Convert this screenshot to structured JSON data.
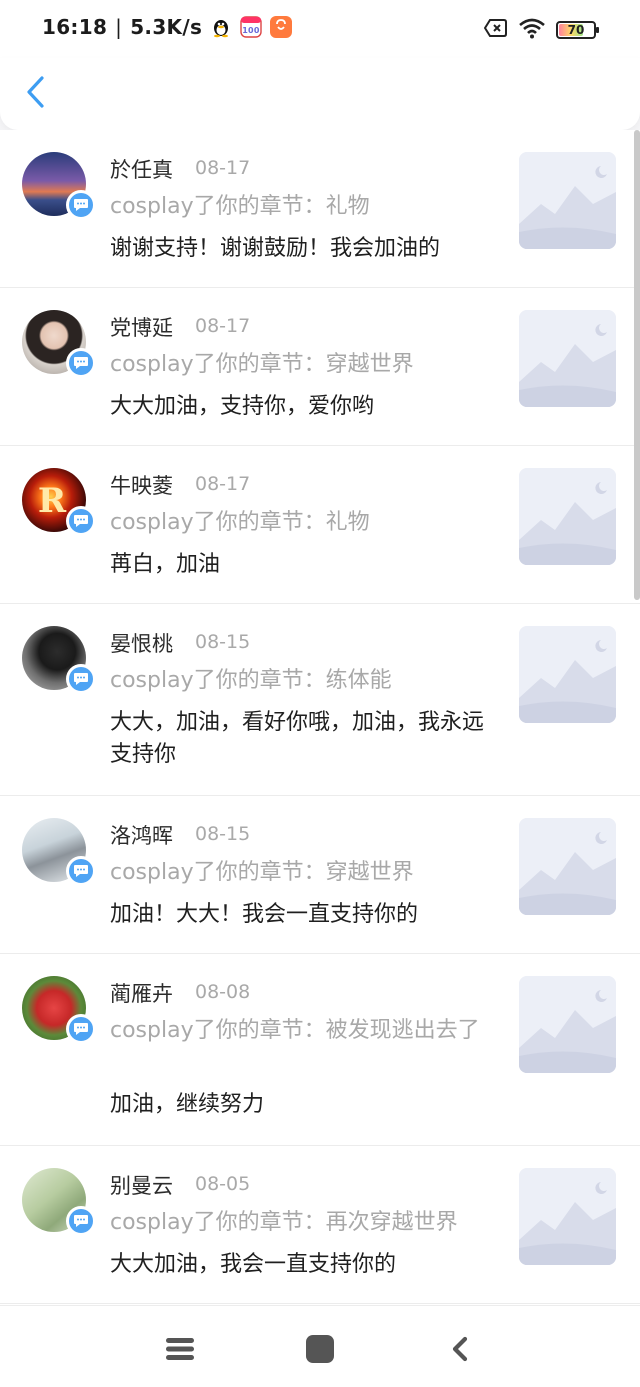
{
  "status_bar": {
    "time": "16:18",
    "separator": "|",
    "speed": "5.3K/s",
    "battery": "70"
  },
  "feed": [
    {
      "name": "於任真",
      "date": "08-17",
      "chapter": "cosplay了你的章节：礼物",
      "comment": "谢谢支持！谢谢鼓励！我会加油的"
    },
    {
      "name": "党博延",
      "date": "08-17",
      "chapter": "cosplay了你的章节：穿越世界",
      "comment": "大大加油，支持你，爱你哟"
    },
    {
      "name": "牛映菱",
      "date": "08-17",
      "chapter": "cosplay了你的章节：礼物",
      "comment": "苒白，加油"
    },
    {
      "name": "晏恨桃",
      "date": "08-15",
      "chapter": "cosplay了你的章节：练体能",
      "comment": "大大，加油，看好你哦，加油，我永远支持你"
    },
    {
      "name": "洛鸿晖",
      "date": "08-15",
      "chapter": "cosplay了你的章节：穿越世界",
      "comment": "加油！大大！我会一直支持你的"
    },
    {
      "name": "蔺雁卉",
      "date": "08-08",
      "chapter": "cosplay了你的章节：被发现逃出去了",
      "comment": "加油，继续努力"
    },
    {
      "name": "别曼云",
      "date": "08-05",
      "chapter": "cosplay了你的章节：再次穿越世界",
      "comment": "大大加油，我会一直支持你的"
    }
  ],
  "icons": {
    "back": "chevron-left-icon",
    "badge": "comment-bubble-icon",
    "thumbnail": "image-placeholder-icon",
    "nav_menu": "menu-icon",
    "nav_home": "home-square-icon",
    "nav_back": "back-arrow-icon"
  },
  "colors": {
    "accent": "#4fa4f4",
    "name_text": "#2b2b2b",
    "muted_text": "#a8a8a8"
  }
}
